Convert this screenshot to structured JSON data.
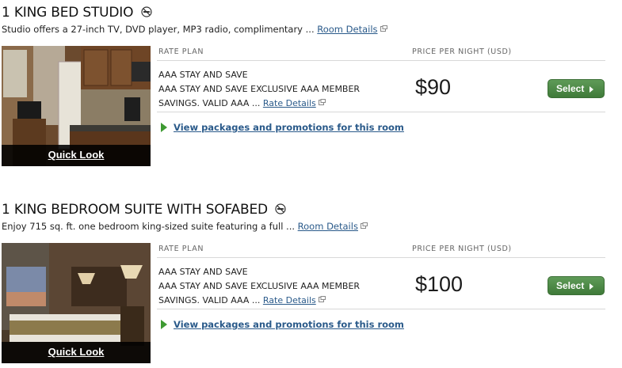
{
  "rooms": [
    {
      "title": "1 KING BED STUDIO",
      "description": "Studio offers a 27-inch TV, DVD player, MP3 radio, complimentary ... ",
      "room_details_link": "Room Details",
      "quick_look": "Quick Look",
      "rate_plan_header": "RATE PLAN",
      "price_header": "PRICE PER NIGHT (USD)",
      "rate_name": "AAA STAY AND SAVE",
      "rate_desc_line1": "AAA STAY AND SAVE EXCLUSIVE AAA MEMBER",
      "rate_desc_line2": "SAVINGS. VALID AAA ... ",
      "rate_details_link": "Rate Details",
      "price": "$90",
      "select_label": "Select",
      "packages_link": "View packages and promotions for this room"
    },
    {
      "title": "1 KING BEDROOM SUITE WITH SOFABED",
      "description": "Enjoy 715 sq. ft. one bedroom king-sized suite featuring a full ... ",
      "room_details_link": "Room Details",
      "quick_look": "Quick Look",
      "rate_plan_header": "RATE PLAN",
      "price_header": "PRICE PER NIGHT (USD)",
      "rate_name": "AAA STAY AND SAVE",
      "rate_desc_line1": "AAA STAY AND SAVE EXCLUSIVE AAA MEMBER",
      "rate_desc_line2": "SAVINGS. VALID AAA ... ",
      "rate_details_link": "Rate Details",
      "price": "$100",
      "select_label": "Select",
      "packages_link": "View packages and promotions for this room"
    }
  ],
  "icons": {
    "no_smoking": "no-smoking-icon",
    "external_link": "external-link-icon"
  },
  "colors": {
    "link": "#2a5a8a",
    "select_button": "#4a8a43",
    "packages_arrow": "#3e9a32"
  }
}
